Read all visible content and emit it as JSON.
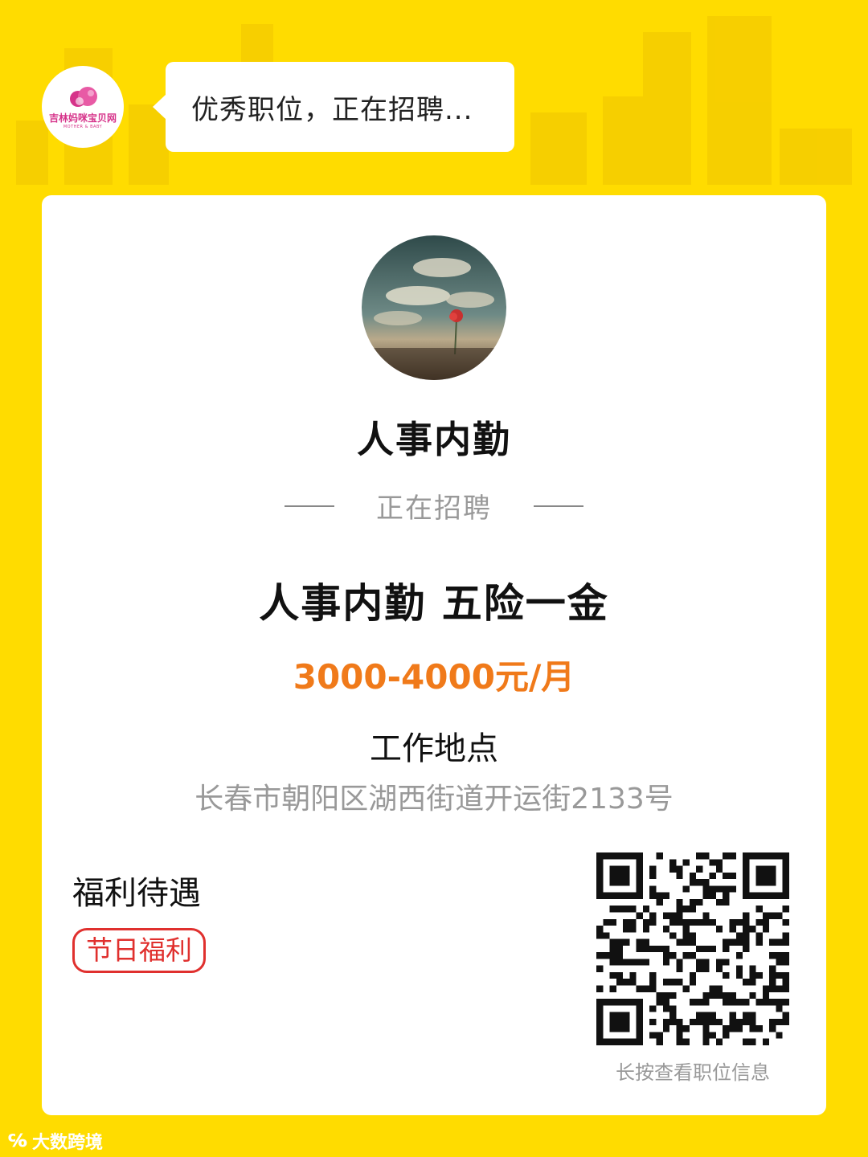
{
  "header": {
    "logo_text": "吉林妈咪宝贝网",
    "logo_subtext": "MOTHER & BABY",
    "bubble_text": "优秀职位，正在招聘..."
  },
  "card": {
    "job_title": "人事内勤",
    "recruiting_label": "正在招聘",
    "headline": "人事内勤 五险一金",
    "salary": "3000-4000元/月",
    "location_label": "工作地点",
    "location_address": "长春市朝阳区湖西街道开运街2133号",
    "benefits_label": "福利待遇",
    "benefits": [
      "节日福利"
    ],
    "qr_caption": "长按查看职位信息"
  },
  "watermark": {
    "icon": "100-logo-icon",
    "text": "大数跨境"
  },
  "colors": {
    "background": "#FFDC00",
    "salary": "#F07A1A",
    "tag": "#E0302E",
    "logo": "#D6338A"
  }
}
